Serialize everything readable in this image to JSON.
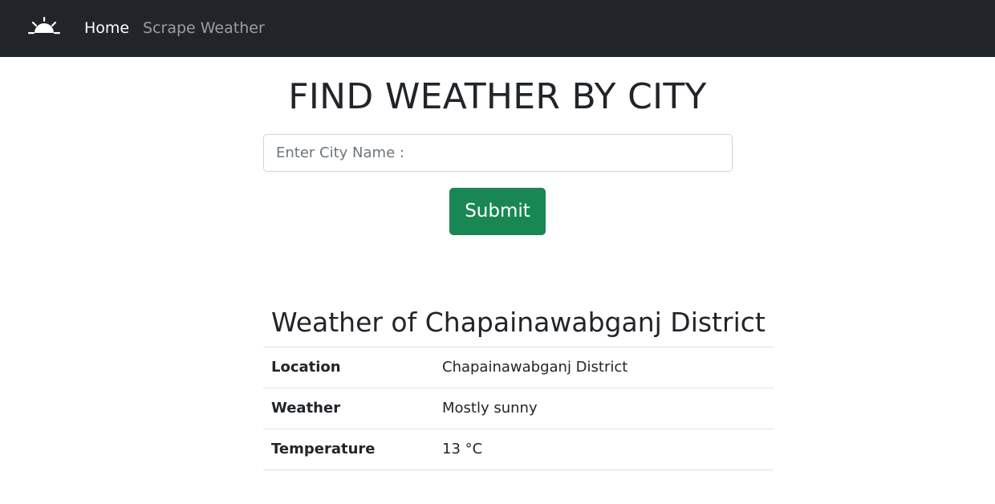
{
  "navbar": {
    "brand_icon": "sunrise-icon",
    "links": [
      {
        "label": "Home",
        "active": true
      },
      {
        "label": "Scrape Weather",
        "active": false
      }
    ],
    "background": "#212529"
  },
  "main": {
    "title": "FIND WEATHER BY CITY",
    "search": {
      "placeholder": "Enter City Name :",
      "value": ""
    },
    "submit_label": "Submit",
    "submit_color": "#198754"
  },
  "weather": {
    "heading": "Weather of Chapainawabganj District",
    "rows": [
      {
        "key": "Location",
        "value": "Chapainawabganj District"
      },
      {
        "key": "Weather",
        "value": "Mostly sunny"
      },
      {
        "key": "Temperature",
        "value": "13 °C"
      }
    ]
  }
}
